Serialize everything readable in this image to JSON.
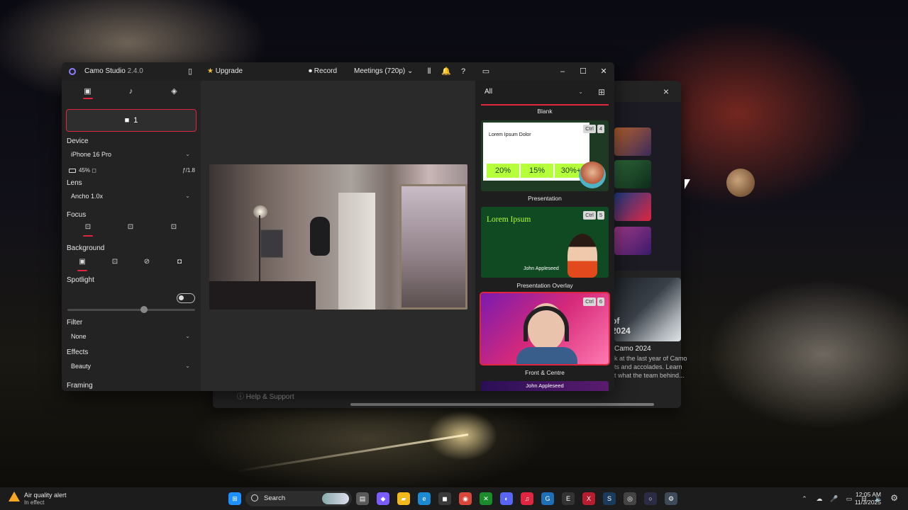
{
  "colors": {
    "accent": "#e0253f",
    "lime": "#b6ff3b",
    "window_bg": "#2b2b2b"
  },
  "back_window": {
    "hero_text": "of\n2024",
    "title": "Camo 2024",
    "description": "k at the last year of Camo\nts and accolades. Learn\nt what the team behind...",
    "help": "Help & Support",
    "close_icon": "×"
  },
  "titlebar": {
    "app_name": "Camo Studio",
    "version": "2.4.0",
    "upgrade": "Upgrade",
    "record": "Record",
    "meetings": "Meetings (720p)",
    "chevron": "⌄",
    "icons": {
      "sidebar": "▯",
      "star": "★",
      "record": "⏺",
      "columns": "⫴",
      "bell": "🔔",
      "help": "?",
      "panel": "▭",
      "minimize": "–",
      "maximize": "☐",
      "close": "✕"
    }
  },
  "left_panel": {
    "tabs": [
      {
        "icon": "camera-icon",
        "glyph": "▣"
      },
      {
        "icon": "mic-icon",
        "glyph": "♪"
      },
      {
        "icon": "layers-icon",
        "glyph": "◈"
      }
    ],
    "camera_label": "1",
    "device_label": "Device",
    "device_value": "iPhone 16 Pro",
    "battery": "45%",
    "aperture": "ƒ/1.8",
    "lens_label": "Lens",
    "lens_value": "Ancho 1.0x",
    "focus_label": "Focus",
    "background_label": "Background",
    "spotlight_label": "Spotlight",
    "spotlight_level": 0.6,
    "filter_label": "Filter",
    "filter_value": "None",
    "effects_label": "Effects",
    "effects_value": "Beauty",
    "framing_label": "Framing"
  },
  "right_panel": {
    "filter_value": "All",
    "grid_icon": "⊞",
    "scenes": [
      {
        "label": "Blank"
      },
      {
        "label": "Presentation",
        "shortcut": [
          "Ctrl",
          "4"
        ],
        "card_title": "Lorem Ipsum Dolor",
        "stats": [
          "20%",
          "15%",
          "30%+"
        ]
      },
      {
        "label": "Presentation Overlay",
        "shortcut": [
          "Ctrl",
          "5"
        ],
        "card_title": "Lorem Ipsum",
        "card_name": "John Appleseed"
      },
      {
        "label": "Front & Centre",
        "shortcut": [
          "Ctrl",
          "6"
        ]
      },
      {
        "label": "John Appleseed"
      }
    ]
  },
  "taskbar": {
    "alert_title": "Air quality alert",
    "alert_sub": "In effect",
    "search": "Search",
    "time": "12:05 AM",
    "date": "11/3/2025",
    "apps": [
      {
        "name": "widgets",
        "glyph": "▤",
        "color": "#5a5a5a"
      },
      {
        "name": "copilot",
        "glyph": "◆",
        "color": "#7b5cff"
      },
      {
        "name": "explorer",
        "glyph": "▰",
        "color": "#f2b91d"
      },
      {
        "name": "edge",
        "glyph": "e",
        "color": "#1b8ad3"
      },
      {
        "name": "store",
        "glyph": "◼",
        "color": "#3a3a3a"
      },
      {
        "name": "chrome",
        "glyph": "◉",
        "color": "#d9463b"
      },
      {
        "name": "xbox",
        "glyph": "✕",
        "color": "#1c8b2c"
      },
      {
        "name": "discord",
        "glyph": "◐",
        "color": "#5865f2"
      },
      {
        "name": "music",
        "glyph": "♫",
        "color": "#e0253f"
      },
      {
        "name": "browser",
        "glyph": "G",
        "color": "#1e6fb8"
      },
      {
        "name": "epic",
        "glyph": "E",
        "color": "#333"
      },
      {
        "name": "app-x",
        "glyph": "X",
        "color": "#b81d2e"
      },
      {
        "name": "steam",
        "glyph": "S",
        "color": "#1b3b5c"
      },
      {
        "name": "obs",
        "glyph": "◎",
        "color": "#444"
      },
      {
        "name": "camo",
        "glyph": "○",
        "color": "#2b2b44"
      },
      {
        "name": "settings",
        "glyph": "⚙",
        "color": "#3c4a5a"
      }
    ],
    "tray": [
      "⌃",
      "☁",
      "🎤",
      "▭",
      "⊟",
      "🔈"
    ]
  }
}
